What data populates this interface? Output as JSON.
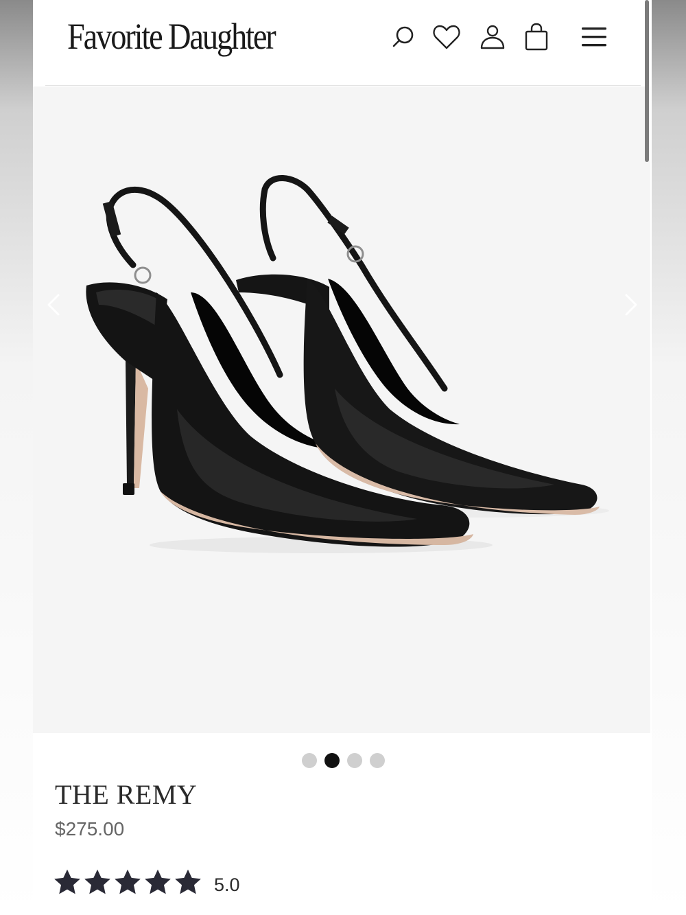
{
  "brand": {
    "logo_text": "Favorite Daughter"
  },
  "header": {
    "icons": [
      "search-icon",
      "heart-icon",
      "account-icon",
      "bag-icon",
      "menu-icon"
    ]
  },
  "gallery": {
    "image_alt": "Black leather pointed-toe slingback pump pair",
    "slide_count": 4,
    "active_slide": 2,
    "prev_icon": "chevron-left-icon",
    "next_icon": "chevron-right-icon"
  },
  "product": {
    "name": "THE REMY",
    "price": "$275.00",
    "rating": {
      "stars": 5,
      "value": "5.0"
    }
  },
  "colors": {
    "text": "#2a2a2a",
    "star": "#2a2a36",
    "dot_active": "#111111",
    "dot_inactive": "#cfcfcf"
  }
}
